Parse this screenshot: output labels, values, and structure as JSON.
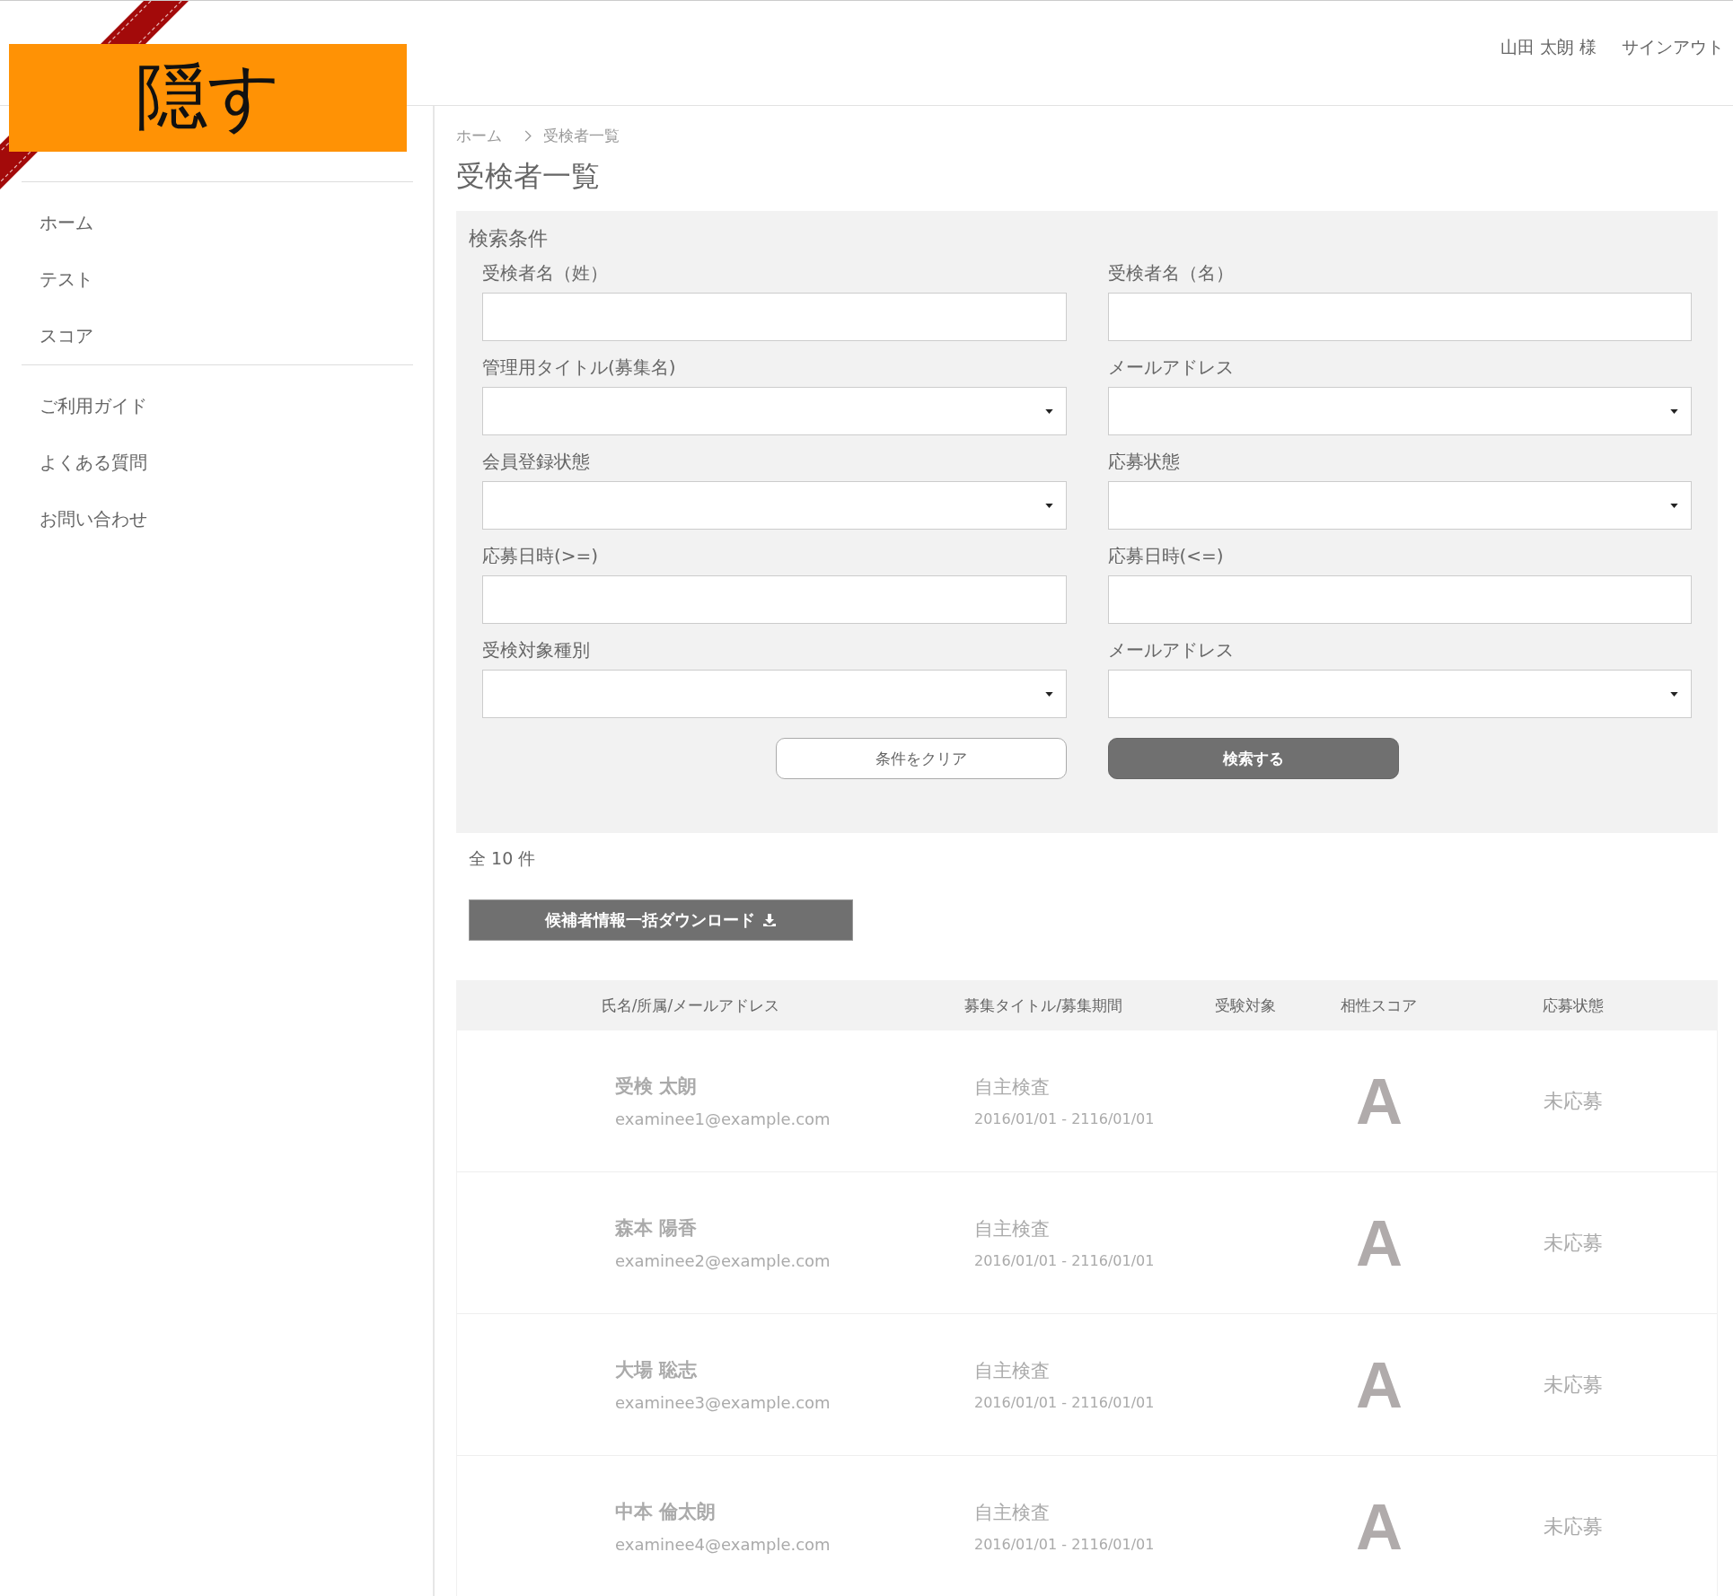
{
  "header": {
    "user": "山田 太朗 様",
    "signout": "サインアウト"
  },
  "redaction_label": "隠す",
  "sidebar": {
    "groups": [
      [
        {
          "label": "ホーム"
        },
        {
          "label": "テスト"
        },
        {
          "label": "スコア"
        }
      ],
      [
        {
          "label": "ご利用ガイド"
        },
        {
          "label": "よくある質問"
        },
        {
          "label": "お問い合わせ"
        }
      ]
    ]
  },
  "breadcrumb": [
    "ホーム",
    "受検者一覧"
  ],
  "page_title": "受検者一覧",
  "search": {
    "title": "検索条件",
    "fields": [
      {
        "label": "受検者名（姓）",
        "kind": "text"
      },
      {
        "label": "受検者名（名）",
        "kind": "text"
      },
      {
        "label": "管理用タイトル(募集名)",
        "kind": "select"
      },
      {
        "label": "メールアドレス",
        "kind": "select"
      },
      {
        "label": "会員登録状態",
        "kind": "select"
      },
      {
        "label": "応募状態",
        "kind": "select"
      },
      {
        "label": "応募日時(>=)",
        "kind": "text"
      },
      {
        "label": "応募日時(<=)",
        "kind": "text"
      },
      {
        "label": "受検対象種別",
        "kind": "select"
      },
      {
        "label": "メールアドレス",
        "kind": "select"
      }
    ],
    "clear_button": "条件をクリア",
    "search_button": "検索する"
  },
  "count": "全 10 件",
  "download_button": "候補者情報一括ダウンロード",
  "table": {
    "columns": [
      "氏名/所属/メールアドレス",
      "募集タイトル/募集期間",
      "受験対象",
      "相性スコア",
      "応募状態"
    ],
    "rows": [
      {
        "name": "受検 太朗",
        "email": "examinee1@example.com",
        "title": "自主検査",
        "period": "2016/01/01 - 2116/01/01",
        "score": "A",
        "status": "未応募"
      },
      {
        "name": "森本 陽香",
        "email": "examinee2@example.com",
        "title": "自主検査",
        "period": "2016/01/01 - 2116/01/01",
        "score": "A",
        "status": "未応募"
      },
      {
        "name": "大場 聡志",
        "email": "examinee3@example.com",
        "title": "自主検査",
        "period": "2016/01/01 - 2116/01/01",
        "score": "A",
        "status": "未応募"
      },
      {
        "name": "中本 倫太朗",
        "email": "examinee4@example.com",
        "title": "自主検査",
        "period": "2016/01/01 - 2116/01/01",
        "score": "A",
        "status": "未応募"
      }
    ]
  }
}
